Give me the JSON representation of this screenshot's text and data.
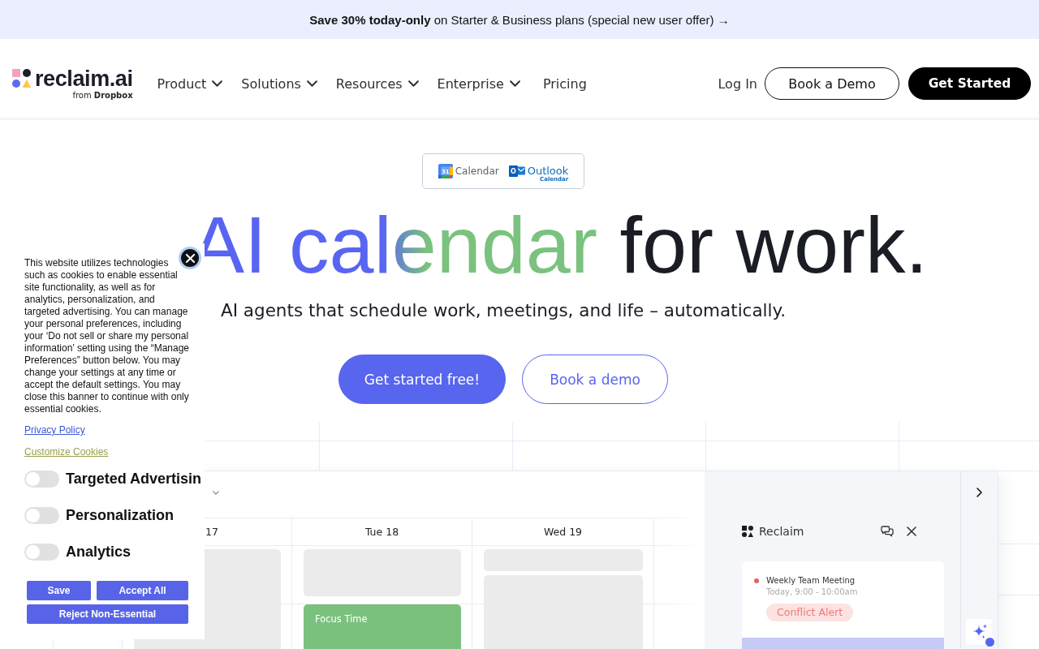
{
  "promo_bar": {
    "text": "**Save 30% today-only** on Starter & Business plans (special new user offer) →"
  },
  "nav": {
    "logo": {
      "wordmark": "reclaim.ai",
      "byline": "from **Dropbox**"
    },
    "items": [
      {
        "label": "Product",
        "kind": "menu"
      },
      {
        "label": "Solutions",
        "kind": "menu"
      },
      {
        "label": "Resources",
        "kind": "menu"
      },
      {
        "label": "Enterprise",
        "kind": "menu"
      },
      {
        "label": "Pricing",
        "kind": "link"
      }
    ],
    "login": "Log In",
    "buttons": [
      {
        "label": "Book a Demo",
        "kind": "outline"
      },
      {
        "label": "Get Started",
        "kind": "filled"
      }
    ]
  },
  "hero": {
    "integrations": [
      {
        "kind": "google",
        "icon_text": "31",
        "label": "Calendar"
      },
      {
        "kind": "outlook",
        "icon_text": "O",
        "label": "Outlook",
        "sublabel": "Calendar"
      }
    ],
    "headline": [
      {
        "text": "AI calendar",
        "kind": "gradient"
      },
      {
        "text": "for work.",
        "kind": "plain"
      }
    ],
    "subtitle": "AI agents that schedule work, meetings, and life – automatically.",
    "buttons": [
      {
        "label": "Get started free!",
        "kind": "filled"
      },
      {
        "label": "Book a demo",
        "kind": "outline"
      }
    ]
  },
  "calendar_preview": {
    "days": [
      {
        "label": "17",
        "events": [
          {
            "kind": "busy"
          }
        ]
      },
      {
        "label": "Tue 18",
        "events": [
          {
            "kind": "busy"
          },
          {
            "kind": "focus",
            "label": "Focus Time"
          }
        ]
      },
      {
        "label": "Wed 19",
        "events": [
          {
            "kind": "busy"
          },
          {
            "kind": "busy"
          }
        ]
      }
    ],
    "assistant_panel": {
      "title": "Reclaim",
      "event": {
        "title": "Weekly Team Meeting",
        "time": "Today, 9:00 - 10:00am",
        "alert": "Conflict Alert"
      }
    }
  },
  "cookie_banner": {
    "text": "This website utilizes technologies such as cookies to enable essential site functionality, as well as for analytics, personalization, and targeted advertising. You can manage your personal preferences, including your ‘Do not sell or share my personal information’ setting using the “Manage Preferences” button below. You may change your settings at any time or accept the default settings. You may close this banner to continue with only essential cookies.",
    "privacy_link": "Privacy Policy",
    "customize_link": "Customize Cookies",
    "preferences": [
      {
        "label": "Targeted Advertisin",
        "on": false
      },
      {
        "label": "Personalization",
        "on": false
      },
      {
        "label": "Analytics",
        "on": false
      }
    ],
    "buttons": [
      "Save",
      "Accept All",
      "Reject Non-Essential"
    ]
  }
}
